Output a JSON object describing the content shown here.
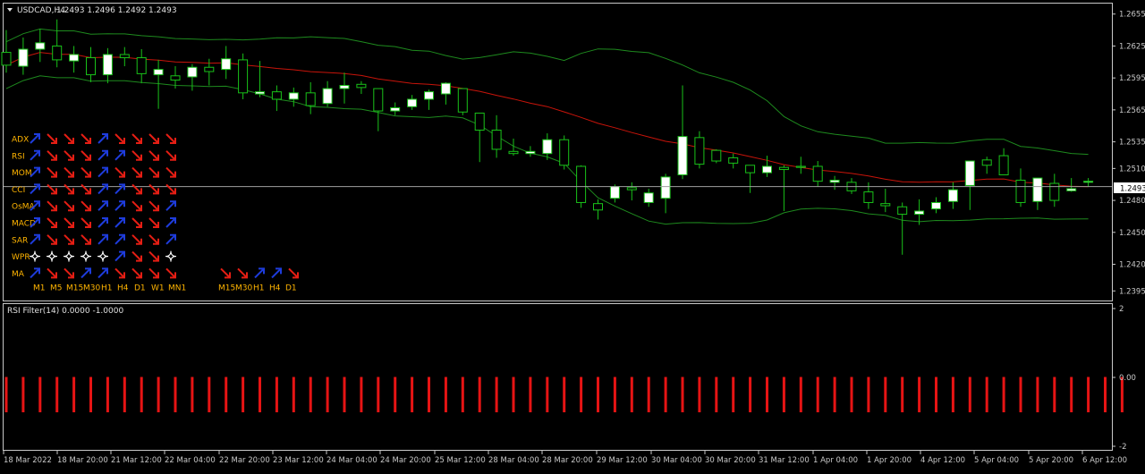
{
  "main_panel": {
    "symbol_label": "USDCAD,H4",
    "ohlc_label": "1.2493 1.2496 1.2492 1.2493",
    "menu_icon": "triangle-down-icon"
  },
  "colors": {
    "background": "#000000",
    "frame": "#c8c8c8",
    "bull_fill": "#ffffff",
    "bear_fill": "#000000",
    "candle_outline": "#19c219",
    "bollinger": "#1e8a1e",
    "ma": "#c8140a",
    "bid_line": "#a0a0a0",
    "label_orange": "#ffb400",
    "arrow_up": "#1e3cdc",
    "arrow_down": "#e61e14",
    "rsi_bar": "#e61414",
    "axis_text": "#c8c8c8"
  },
  "y_axis": {
    "ticks": [
      "1.2655",
      "1.2625",
      "1.2595",
      "1.2565",
      "1.2535",
      "1.2510",
      "1.2480",
      "1.2450",
      "1.2420",
      "1.2395"
    ],
    "current_price_label": "1.2493"
  },
  "x_axis": {
    "labels": [
      "18 Mar 2022",
      "18 Mar 20:00",
      "21 Mar 12:00",
      "22 Mar 04:00",
      "22 Mar 20:00",
      "23 Mar 12:00",
      "24 Mar 04:00",
      "24 Mar 20:00",
      "25 Mar 12:00",
      "28 Mar 04:00",
      "28 Mar 20:00",
      "29 Mar 12:00",
      "30 Mar 04:00",
      "30 Mar 20:00",
      "31 Mar 12:00",
      "1 Apr 04:00",
      "1 Apr 20:00",
      "4 Apr 12:00",
      "5 Apr 04:00",
      "5 Apr 20:00",
      "6 Apr 12:00"
    ]
  },
  "signal_matrix": {
    "rows": [
      {
        "label": "ADX",
        "signals": [
          "up",
          "down",
          "down",
          "down",
          "up",
          "down",
          "down",
          "down",
          "down"
        ]
      },
      {
        "label": "RSI",
        "signals": [
          "up",
          "down",
          "down",
          "down",
          "up",
          "up",
          "down",
          "down",
          "down"
        ]
      },
      {
        "label": "MOM",
        "signals": [
          "up",
          "down",
          "down",
          "down",
          "up",
          "down",
          "down",
          "down",
          "down"
        ]
      },
      {
        "label": "CCI",
        "signals": [
          "up",
          "down",
          "down",
          "down",
          "up",
          "up",
          "down",
          "down",
          "down"
        ]
      },
      {
        "label": "OsMA",
        "signals": [
          "up",
          "down",
          "down",
          "down",
          "up",
          "up",
          "down",
          "down",
          "up"
        ]
      },
      {
        "label": "MACD",
        "signals": [
          "up",
          "down",
          "down",
          "down",
          "up",
          "up",
          "down",
          "down",
          "up"
        ]
      },
      {
        "label": "SAR",
        "signals": [
          "up",
          "down",
          "down",
          "down",
          "up",
          "up",
          "down",
          "down",
          "up"
        ]
      },
      {
        "label": "WPR",
        "signals": [
          "star",
          "star",
          "star",
          "star",
          "star",
          "up",
          "down",
          "down",
          "star"
        ]
      },
      {
        "label": "MA",
        "signals": [
          "up",
          "down",
          "down",
          "up",
          "up",
          "down",
          "down",
          "down",
          "down"
        ]
      }
    ],
    "timeframes": [
      "M1",
      "M5",
      "M15",
      "M30",
      "H1",
      "H4",
      "D1",
      "W1",
      "MN1"
    ],
    "second_group": {
      "signals": [
        "down",
        "down",
        "up",
        "up",
        "down"
      ],
      "timeframes": [
        "M15",
        "M30",
        "H1",
        "H4",
        "D1"
      ]
    }
  },
  "sub_panel": {
    "title": "RSI Filter(14) 0.0000 -1.0000",
    "y_ticks": [
      "2",
      "0.00",
      "-2"
    ],
    "rsi_value": -1,
    "bar_count": 67
  },
  "chart_data": [
    {
      "type": "candlestick",
      "title": "USDCAD,H4",
      "ylim": [
        1.2386,
        1.2664
      ],
      "current_price": 1.2493,
      "indicators": [
        "Bollinger Bands",
        "Moving Average"
      ],
      "candles": [
        {
          "o": 1.2619,
          "h": 1.264,
          "l": 1.26,
          "c": 1.2607
        },
        {
          "o": 1.2606,
          "h": 1.2633,
          "l": 1.2598,
          "c": 1.2622
        },
        {
          "o": 1.2622,
          "h": 1.2641,
          "l": 1.261,
          "c": 1.2628
        },
        {
          "o": 1.2625,
          "h": 1.265,
          "l": 1.2605,
          "c": 1.2612
        },
        {
          "o": 1.2611,
          "h": 1.2625,
          "l": 1.26,
          "c": 1.2617
        },
        {
          "o": 1.2614,
          "h": 1.2624,
          "l": 1.2591,
          "c": 1.2598
        },
        {
          "o": 1.2598,
          "h": 1.2623,
          "l": 1.259,
          "c": 1.2617
        },
        {
          "o": 1.2617,
          "h": 1.2624,
          "l": 1.2606,
          "c": 1.2614
        },
        {
          "o": 1.2614,
          "h": 1.2622,
          "l": 1.259,
          "c": 1.2599
        },
        {
          "o": 1.2598,
          "h": 1.2612,
          "l": 1.2566,
          "c": 1.2603
        },
        {
          "o": 1.2597,
          "h": 1.2606,
          "l": 1.2585,
          "c": 1.2593
        },
        {
          "o": 1.2596,
          "h": 1.2608,
          "l": 1.2583,
          "c": 1.2605
        },
        {
          "o": 1.2605,
          "h": 1.2613,
          "l": 1.2588,
          "c": 1.2601
        },
        {
          "o": 1.2603,
          "h": 1.2625,
          "l": 1.2594,
          "c": 1.2613
        },
        {
          "o": 1.2612,
          "h": 1.2618,
          "l": 1.2575,
          "c": 1.2581
        },
        {
          "o": 1.258,
          "h": 1.2611,
          "l": 1.2577,
          "c": 1.2582
        },
        {
          "o": 1.2582,
          "h": 1.2588,
          "l": 1.2564,
          "c": 1.2575
        },
        {
          "o": 1.2575,
          "h": 1.2586,
          "l": 1.2568,
          "c": 1.2581
        },
        {
          "o": 1.2581,
          "h": 1.2591,
          "l": 1.2561,
          "c": 1.2569
        },
        {
          "o": 1.2571,
          "h": 1.2592,
          "l": 1.2568,
          "c": 1.2585
        },
        {
          "o": 1.2585,
          "h": 1.26,
          "l": 1.2571,
          "c": 1.2588
        },
        {
          "o": 1.2589,
          "h": 1.2592,
          "l": 1.258,
          "c": 1.2586
        },
        {
          "o": 1.2585,
          "h": 1.2585,
          "l": 1.2545,
          "c": 1.2564
        },
        {
          "o": 1.2564,
          "h": 1.2572,
          "l": 1.256,
          "c": 1.2567
        },
        {
          "o": 1.2568,
          "h": 1.2579,
          "l": 1.2565,
          "c": 1.2575
        },
        {
          "o": 1.2575,
          "h": 1.2584,
          "l": 1.2565,
          "c": 1.2582
        },
        {
          "o": 1.258,
          "h": 1.2591,
          "l": 1.257,
          "c": 1.259
        },
        {
          "o": 1.2585,
          "h": 1.2585,
          "l": 1.256,
          "c": 1.2563
        },
        {
          "o": 1.2562,
          "h": 1.256,
          "l": 1.2516,
          "c": 1.2546
        },
        {
          "o": 1.2546,
          "h": 1.256,
          "l": 1.252,
          "c": 1.2528
        },
        {
          "o": 1.2526,
          "h": 1.2538,
          "l": 1.2522,
          "c": 1.2524
        },
        {
          "o": 1.2524,
          "h": 1.2531,
          "l": 1.2521,
          "c": 1.2526
        },
        {
          "o": 1.2524,
          "h": 1.2543,
          "l": 1.2518,
          "c": 1.2537
        },
        {
          "o": 1.2537,
          "h": 1.2541,
          "l": 1.2509,
          "c": 1.2513
        },
        {
          "o": 1.2512,
          "h": 1.2513,
          "l": 1.2473,
          "c": 1.2478
        },
        {
          "o": 1.2477,
          "h": 1.2481,
          "l": 1.2462,
          "c": 1.2471
        },
        {
          "o": 1.2482,
          "h": 1.2495,
          "l": 1.2478,
          "c": 1.2493
        },
        {
          "o": 1.2492,
          "h": 1.2497,
          "l": 1.248,
          "c": 1.249
        },
        {
          "o": 1.2478,
          "h": 1.2491,
          "l": 1.2474,
          "c": 1.2487
        },
        {
          "o": 1.2482,
          "h": 1.2505,
          "l": 1.2468,
          "c": 1.2502
        },
        {
          "o": 1.2504,
          "h": 1.2588,
          "l": 1.25,
          "c": 1.254
        },
        {
          "o": 1.2539,
          "h": 1.2545,
          "l": 1.251,
          "c": 1.2514
        },
        {
          "o": 1.2527,
          "h": 1.2528,
          "l": 1.2515,
          "c": 1.2517
        },
        {
          "o": 1.252,
          "h": 1.2524,
          "l": 1.251,
          "c": 1.2515
        },
        {
          "o": 1.2513,
          "h": 1.2513,
          "l": 1.2487,
          "c": 1.2506
        },
        {
          "o": 1.2506,
          "h": 1.2522,
          "l": 1.2502,
          "c": 1.2512
        },
        {
          "o": 1.2511,
          "h": 1.2513,
          "l": 1.247,
          "c": 1.2509
        },
        {
          "o": 1.2512,
          "h": 1.2521,
          "l": 1.2505,
          "c": 1.2511
        },
        {
          "o": 1.2512,
          "h": 1.2517,
          "l": 1.2493,
          "c": 1.2498
        },
        {
          "o": 1.2497,
          "h": 1.2503,
          "l": 1.249,
          "c": 1.2499
        },
        {
          "o": 1.2497,
          "h": 1.2501,
          "l": 1.2486,
          "c": 1.2489
        },
        {
          "o": 1.2488,
          "h": 1.2497,
          "l": 1.2472,
          "c": 1.2478
        },
        {
          "o": 1.2477,
          "h": 1.2491,
          "l": 1.2469,
          "c": 1.2475
        },
        {
          "o": 1.2474,
          "h": 1.2478,
          "l": 1.2429,
          "c": 1.2467
        },
        {
          "o": 1.2467,
          "h": 1.2481,
          "l": 1.2457,
          "c": 1.247
        },
        {
          "o": 1.2472,
          "h": 1.2483,
          "l": 1.2468,
          "c": 1.2478
        },
        {
          "o": 1.2479,
          "h": 1.2497,
          "l": 1.2472,
          "c": 1.249
        },
        {
          "o": 1.2494,
          "h": 1.2517,
          "l": 1.2471,
          "c": 1.2517
        },
        {
          "o": 1.2518,
          "h": 1.2521,
          "l": 1.2505,
          "c": 1.2513
        },
        {
          "o": 1.2522,
          "h": 1.2529,
          "l": 1.2505,
          "c": 1.2504
        },
        {
          "o": 1.2499,
          "h": 1.251,
          "l": 1.2474,
          "c": 1.2478
        },
        {
          "o": 1.2479,
          "h": 1.2501,
          "l": 1.2471,
          "c": 1.2501
        },
        {
          "o": 1.2496,
          "h": 1.2505,
          "l": 1.2474,
          "c": 1.248
        },
        {
          "o": 1.2489,
          "h": 1.2501,
          "l": 1.2488,
          "c": 1.2491
        },
        {
          "o": 1.2497,
          "h": 1.2501,
          "l": 1.2493,
          "c": 1.2498
        }
      ]
    },
    {
      "type": "bar",
      "title": "RSI Filter(14) 0.0000 -1.0000",
      "ylim": [
        -2,
        2
      ],
      "value": -1
    }
  ]
}
